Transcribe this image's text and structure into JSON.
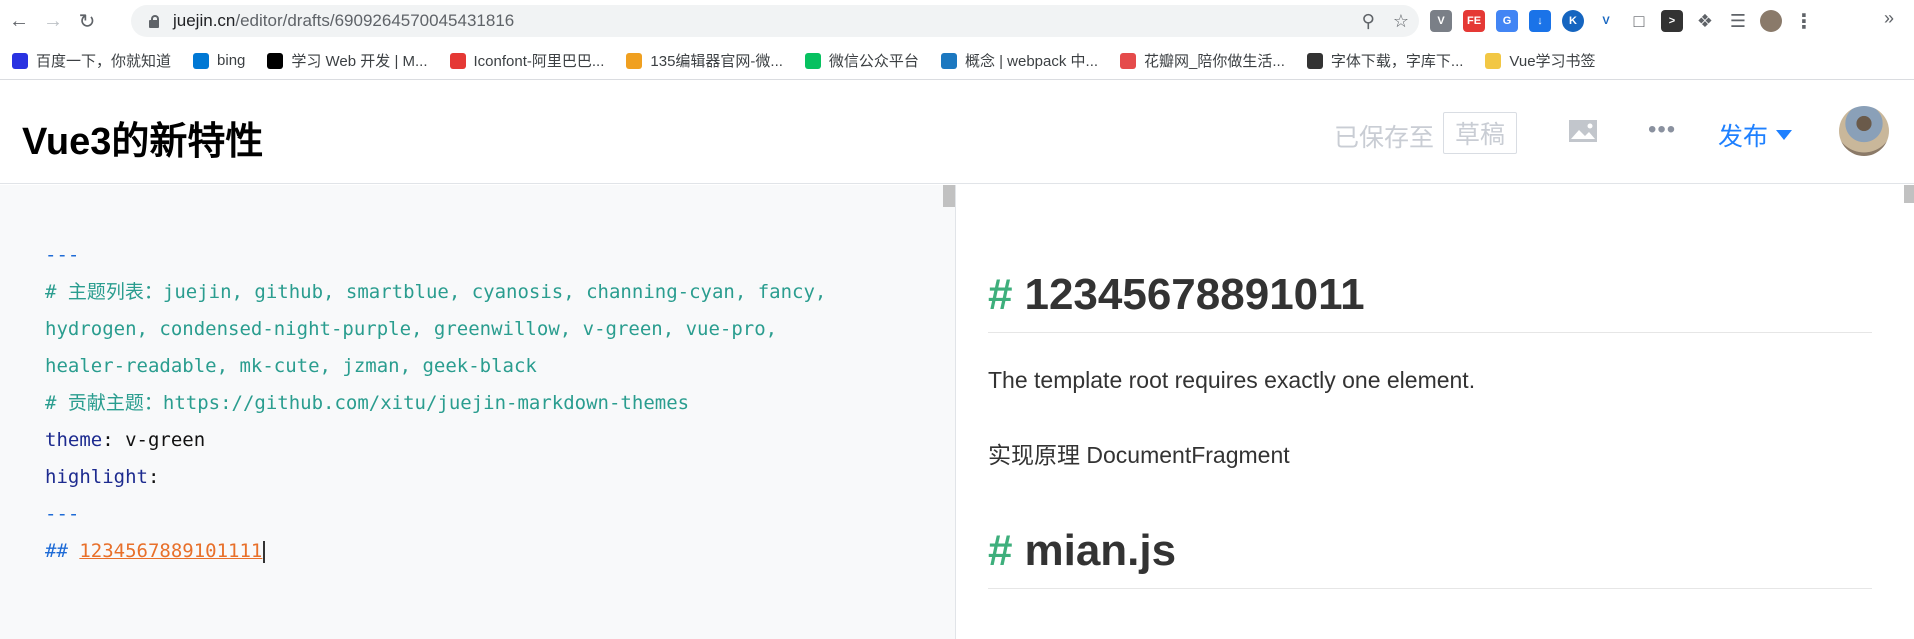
{
  "browser": {
    "url_host": "juejin.cn",
    "url_path": "/editor/drafts/6909264570045431816",
    "bookmarks": [
      {
        "label": "百度一下，你就知道",
        "icon": "baidu-icon",
        "color": "#2932e1"
      },
      {
        "label": "bing",
        "icon": "bing-icon",
        "color": "#0078d4"
      },
      {
        "label": "学习 Web 开发 | M...",
        "icon": "mdn-icon",
        "color": "#000000"
      },
      {
        "label": "Iconfont-阿里巴巴...",
        "icon": "iconfont-icon",
        "color": "#e53935"
      },
      {
        "label": "135编辑器官网-微...",
        "icon": "135-icon",
        "color": "#f0a020"
      },
      {
        "label": "微信公众平台",
        "icon": "wechat-icon",
        "color": "#07c160"
      },
      {
        "label": "概念 | webpack 中...",
        "icon": "webpack-icon",
        "color": "#1c78c0"
      },
      {
        "label": "花瓣网_陪你做生活...",
        "icon": "huaban-icon",
        "color": "#e54b4b"
      },
      {
        "label": "字体下载，字库下...",
        "icon": "globe-icon",
        "color": "#333333"
      },
      {
        "label": "Vue学习书签",
        "icon": "folder-icon",
        "color": "#f2c744"
      }
    ]
  },
  "editor": {
    "title": "Vue3的新特性",
    "saved_label": "已保存至",
    "draft_label": "草稿",
    "publish_label": "发布",
    "accent_color": "#1e80ff"
  },
  "source": {
    "line1": "---",
    "line2": "# 主题列表：juejin, github, smartblue, cyanosis, channing-cyan, fancy,",
    "line3": "hydrogen, condensed-night-purple, greenwillow, v-green, vue-pro,",
    "line4": "healer-readable, mk-cute, jzman, geek-black",
    "line5": "# 贡献主题：https://github.com/xitu/juejin-markdown-themes",
    "theme_key": "theme",
    "theme_sep": ":",
    "theme_value": " v-green",
    "highlight_key": "highlight",
    "highlight_sep": ":",
    "line8": "---",
    "heading_mark": "##",
    "heading_text": "1234567889101111"
  },
  "preview": {
    "hash": "#",
    "heading1": "12345678891011",
    "para1": "The template root requires exactly one element.",
    "para2": "实现原理 DocumentFragment",
    "heading2": "mian.js",
    "hash_color": "#3eaf7c"
  }
}
